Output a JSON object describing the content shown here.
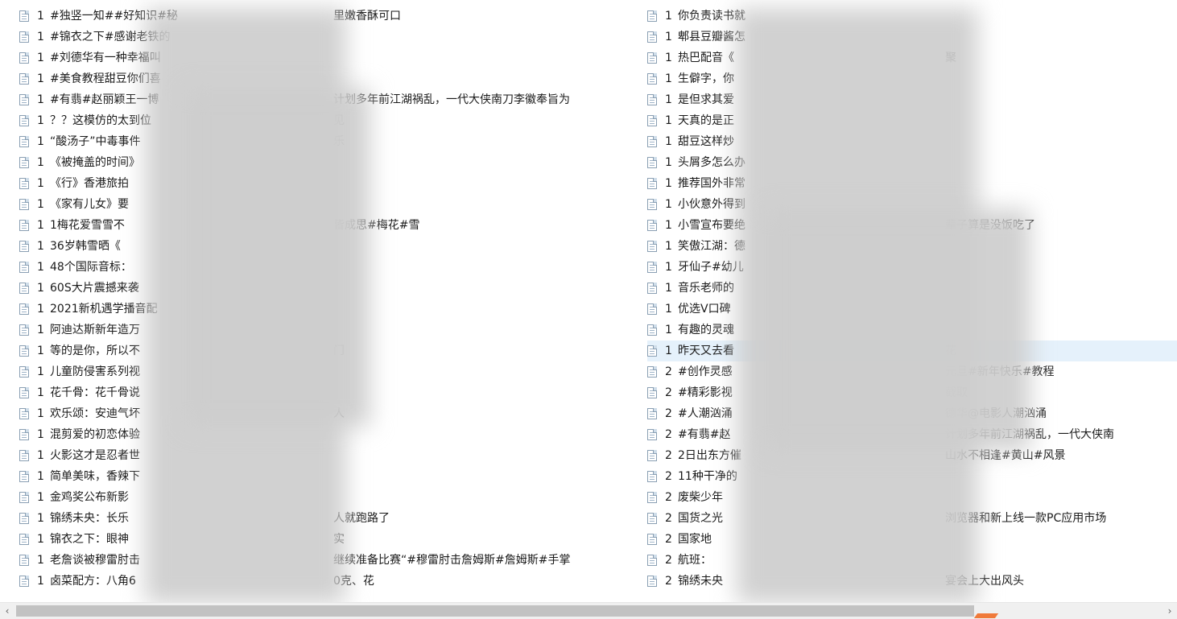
{
  "left_column": [
    {
      "num": "1",
      "text": "#独竖一知##好知识#秘",
      "tail": "里嫩香酥可口"
    },
    {
      "num": "1",
      "text": "#锦衣之下#感谢老铁的",
      "tail": ""
    },
    {
      "num": "1",
      "text": "#刘德华有一种幸福叫",
      "tail": ""
    },
    {
      "num": "1",
      "text": "#美食教程甜豆你们喜",
      "tail": ""
    },
    {
      "num": "1",
      "text": "#有翡#赵丽颖王一博",
      "tail": "计划多年前江湖祸乱，一代大侠南刀李徽奉旨为"
    },
    {
      "num": "1",
      "text": "？？这模仿的太到位",
      "tail": "见"
    },
    {
      "num": "1",
      "text": "“酸汤子”中毒事件",
      "tail": "乐"
    },
    {
      "num": "1",
      "text": "《被掩盖的时间》",
      "tail": ""
    },
    {
      "num": "1",
      "text": "《行》香港旅拍",
      "tail": ""
    },
    {
      "num": "1",
      "text": "《家有儿女》要",
      "tail": ""
    },
    {
      "num": "1",
      "text": "1梅花爱雪雪不",
      "tail": "皆成思#梅花#雪"
    },
    {
      "num": "1",
      "text": "36岁韩雪晒《",
      "tail": ""
    },
    {
      "num": "1",
      "text": "48个国际音标：",
      "tail": ""
    },
    {
      "num": "1",
      "text": "60S大片震撼来袭",
      "tail": ""
    },
    {
      "num": "1",
      "text": "2021新机遇学播音配",
      "tail": ""
    },
    {
      "num": "1",
      "text": "阿迪达斯新年造万",
      "tail": ""
    },
    {
      "num": "1",
      "text": "等的是你，所以不",
      "tail": "门"
    },
    {
      "num": "1",
      "text": "儿童防侵害系列视",
      "tail": ""
    },
    {
      "num": "1",
      "text": "花千骨：花千骨说",
      "tail": ""
    },
    {
      "num": "1",
      "text": "欢乐颂：安迪气坏",
      "tail": "人"
    },
    {
      "num": "1",
      "text": "混剪爱的初恋体验",
      "tail": ""
    },
    {
      "num": "1",
      "text": "火影这才是忍者世",
      "tail": ""
    },
    {
      "num": "1",
      "text": "简单美味，香辣下",
      "tail": ""
    },
    {
      "num": "1",
      "text": "金鸡奖公布新影",
      "tail": ""
    },
    {
      "num": "1",
      "text": "锦绣未央：长乐",
      "tail": "人就跑路了"
    },
    {
      "num": "1",
      "text": "锦衣之下：眼神",
      "tail": "实"
    },
    {
      "num": "1",
      "text": "老詹谈被穆雷肘击",
      "tail": "继续准备比赛“#穆雷肘击詹姆斯#詹姆斯#手掌"
    },
    {
      "num": "1",
      "text": "卤菜配方：八角6",
      "tail": "0克、花"
    }
  ],
  "right_column": [
    {
      "num": "1",
      "text": "你负责读书就",
      "tail": "",
      "selected": false
    },
    {
      "num": "1",
      "text": "郫县豆瓣酱怎",
      "tail": "",
      "selected": false
    },
    {
      "num": "1",
      "text": "热巴配音《",
      "tail": "聚",
      "selected": false
    },
    {
      "num": "1",
      "text": "生僻字，你",
      "tail": "",
      "selected": false
    },
    {
      "num": "1",
      "text": "是但求其爱",
      "tail": "",
      "selected": false
    },
    {
      "num": "1",
      "text": "天真的是正",
      "tail": "",
      "selected": false
    },
    {
      "num": "1",
      "text": "甜豆这样炒",
      "tail": "",
      "selected": false
    },
    {
      "num": "1",
      "text": "头屑多怎么办",
      "tail": "",
      "selected": false
    },
    {
      "num": "1",
      "text": "推荐国外非常",
      "tail": "",
      "selected": false
    },
    {
      "num": "1",
      "text": "小伙意外得到",
      "tail": "",
      "selected": false
    },
    {
      "num": "1",
      "text": "小雪宣布要绝",
      "tail": "辈子算是没饭吃了",
      "selected": false
    },
    {
      "num": "1",
      "text": "笑傲江湖：德",
      "tail": "",
      "selected": false
    },
    {
      "num": "1",
      "text": "牙仙子#幼儿",
      "tail": "",
      "selected": false
    },
    {
      "num": "1",
      "text": "音乐老师的",
      "tail": "",
      "selected": false
    },
    {
      "num": "1",
      "text": "优选V口碑",
      "tail": "",
      "selected": false
    },
    {
      "num": "1",
      "text": "有趣的灵魂",
      "tail": "",
      "selected": false
    },
    {
      "num": "1",
      "text": "昨天又去看",
      "tail": "花",
      "selected": true
    },
    {
      "num": "2",
      "text": "#创作灵感",
      "tail": "元旦#新年快乐#教程",
      "selected": false
    },
    {
      "num": "2",
      "text": "#精彩影视",
      "tail": "截取",
      "selected": false
    },
    {
      "num": "2",
      "text": "#人潮汹涌",
      "tail": "德华@电影人潮汹涌",
      "selected": false
    },
    {
      "num": "2",
      "text": "#有翡#赵",
      "tail": "计划多年前江湖祸乱，一代大侠南",
      "selected": false
    },
    {
      "num": "2",
      "text": "2日出东方催",
      "tail": "山水不相逢#黄山#风景",
      "selected": false
    },
    {
      "num": "2",
      "text": "11种干净的",
      "tail": "",
      "selected": false
    },
    {
      "num": "2",
      "text": "废柴少年",
      "tail": "",
      "selected": false
    },
    {
      "num": "2",
      "text": "国货之光",
      "tail": "浏览器和新上线一款PC应用市场",
      "selected": false
    },
    {
      "num": "2",
      "text": "国家地",
      "tail": "",
      "selected": false
    },
    {
      "num": "2",
      "text": "航班：",
      "tail": "",
      "selected": false
    },
    {
      "num": "2",
      "text": "锦绣未央",
      "tail": "宴会上大出风头",
      "selected": false
    }
  ],
  "scrollbar": {
    "left_arrow": "‹",
    "right_arrow": "›"
  },
  "icons": {
    "file": "text-file-icon"
  },
  "colors": {
    "selected_row": "#e5f1fb",
    "scroll_thumb": "#c2c2c2",
    "accent": "#f07a3a"
  }
}
